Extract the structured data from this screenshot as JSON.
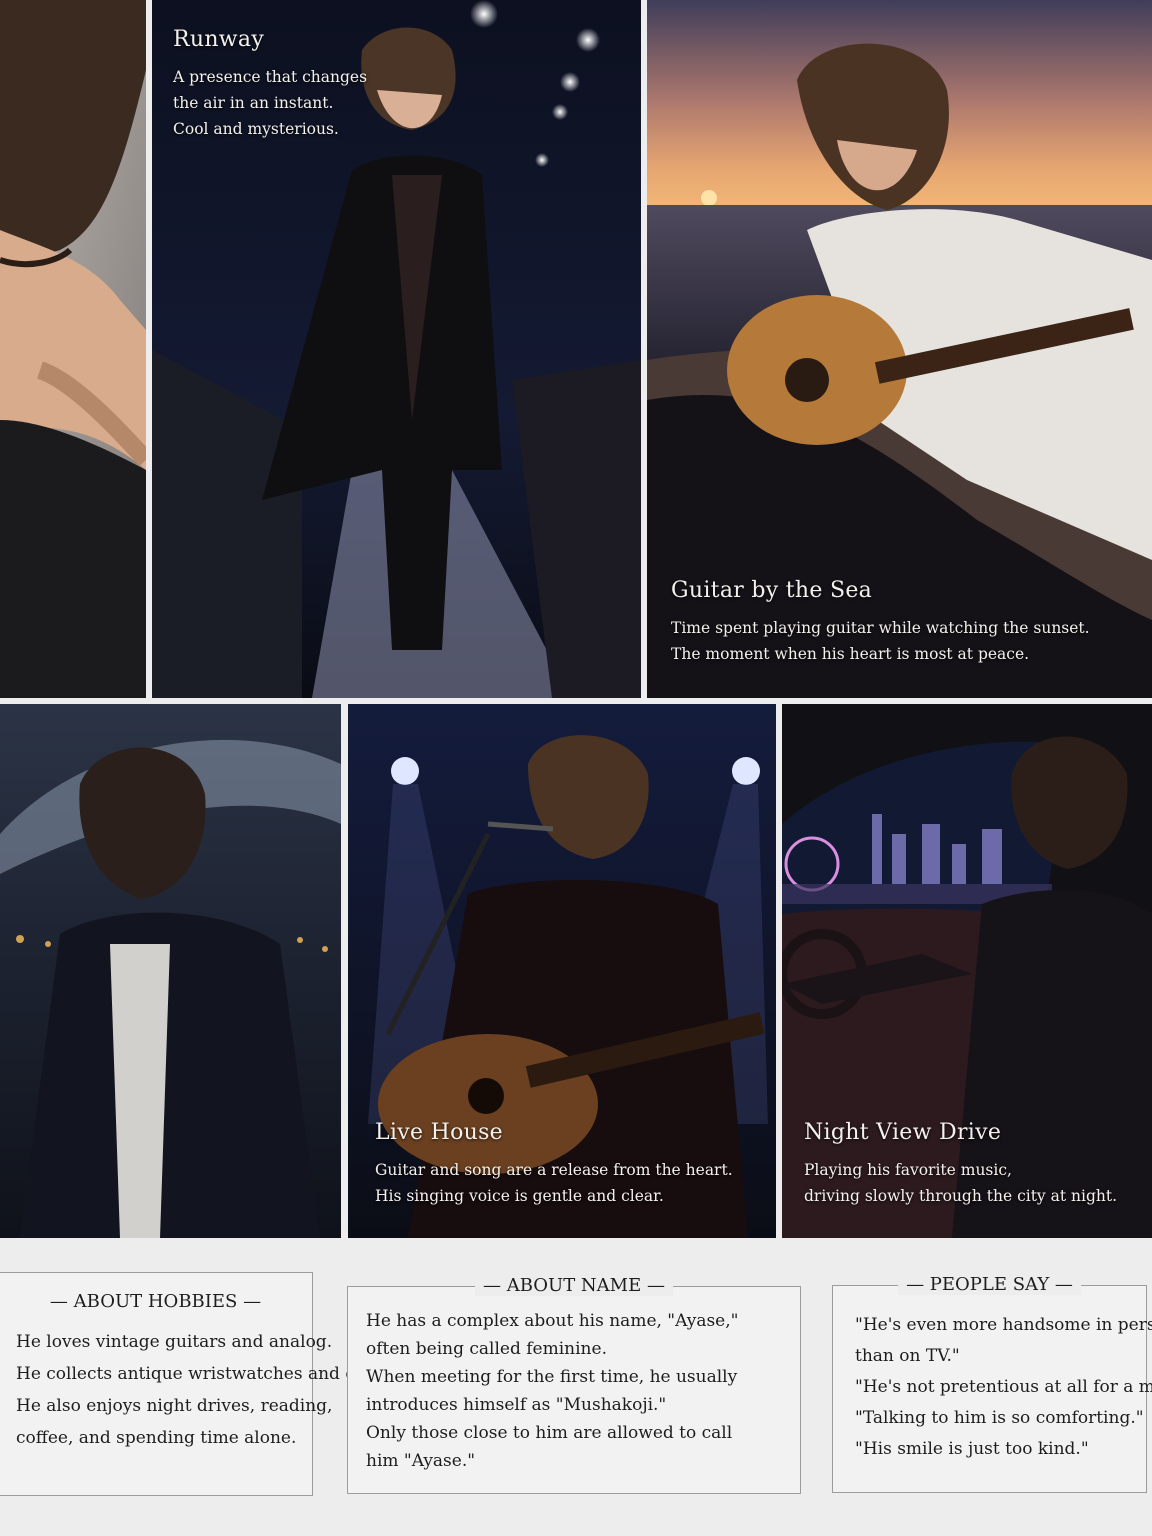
{
  "panels": {
    "closeup": {},
    "runway": {
      "title": "Runway",
      "lines": [
        "A presence that changes",
        "the air in an instant.",
        "Cool and mysterious."
      ]
    },
    "sea": {
      "title": "Guitar by the Sea",
      "lines": [
        "Time spent playing guitar while watching the sunset.",
        "The moment when his heart is most at peace."
      ]
    },
    "rain": {},
    "live": {
      "title": "Live House",
      "lines": [
        "Guitar and song are a release from the heart.",
        "His singing voice is gentle and clear."
      ]
    },
    "drive": {
      "title": "Night View Drive",
      "lines": [
        "Playing his favorite music,",
        "driving slowly through the city at night."
      ]
    }
  },
  "boxes": {
    "hobbies": {
      "heading": "— ABOUT HOBBIES —",
      "lines": [
        "He loves vintage guitars and analog.",
        "He collects antique wristwatches and cameras.",
        "He also enjoys night drives, reading,",
        "coffee, and spending time alone."
      ]
    },
    "name": {
      "heading": "— ABOUT NAME —",
      "lines": [
        "He has a complex about his name, \"Ayase,\"",
        "often being called feminine.",
        "When meeting for the first time, he usually",
        "introduces himself as \"Mushakoji.\"",
        "Only those close to him are allowed to call",
        "him \"Ayase.\""
      ]
    },
    "people": {
      "heading": "— PEOPLE SAY —",
      "lines": [
        "\"He's even more handsome in person",
        "than on TV.\"",
        "\"He's not pretentious at all for a model.\"",
        "\"Talking to him is so comforting.\"",
        "\"His smile is just too kind.\""
      ]
    }
  },
  "colors": {
    "page_bg": "#ededee",
    "box_border": "#9c9c9c",
    "caption_text": "#f4f1ec",
    "sunset_sky": "#c98a6a",
    "night_sky": "#0d1326"
  }
}
